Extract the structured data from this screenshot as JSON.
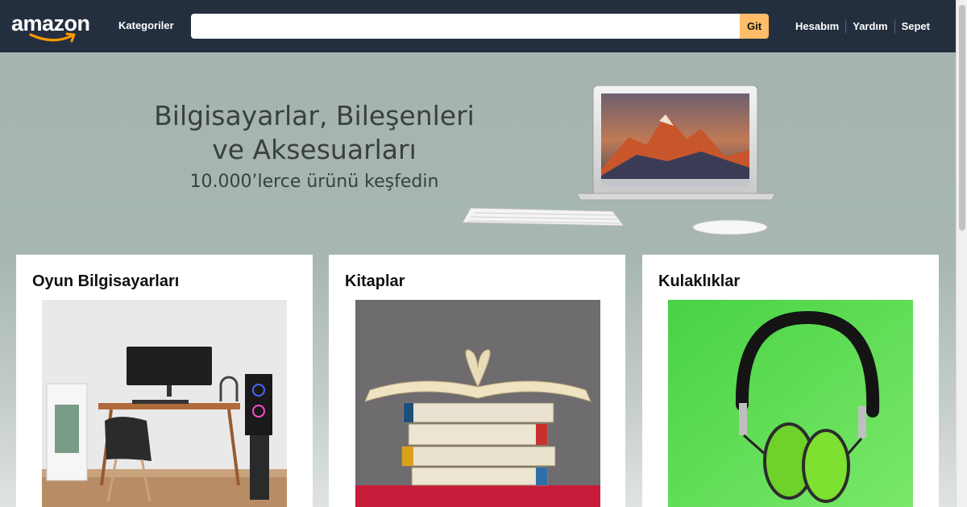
{
  "header": {
    "logo": "amazon",
    "categories_label": "Kategoriler",
    "search_placeholder": "",
    "go_label": "Git",
    "nav": [
      "Hesabım",
      "Yardım",
      "Sepet"
    ]
  },
  "hero": {
    "title_line1": "Bilgisayarlar, Bileşenleri",
    "title_line2": "ve Aksesuarları",
    "subtitle": "10.000’lerce ürünü keşfedin",
    "image_icon": "laptop-keyboard-mouse-image"
  },
  "cards": [
    {
      "title": "Oyun Bilgisayarları",
      "image_icon": "gaming-desk-image"
    },
    {
      "title": "Kitaplar",
      "image_icon": "books-stack-image"
    },
    {
      "title": "Kulaklıklar",
      "image_icon": "headphones-image"
    }
  ],
  "colors": {
    "header_bg": "#232f3e",
    "go_button": "#febd69",
    "hero_bg": "#a5b4b0"
  }
}
